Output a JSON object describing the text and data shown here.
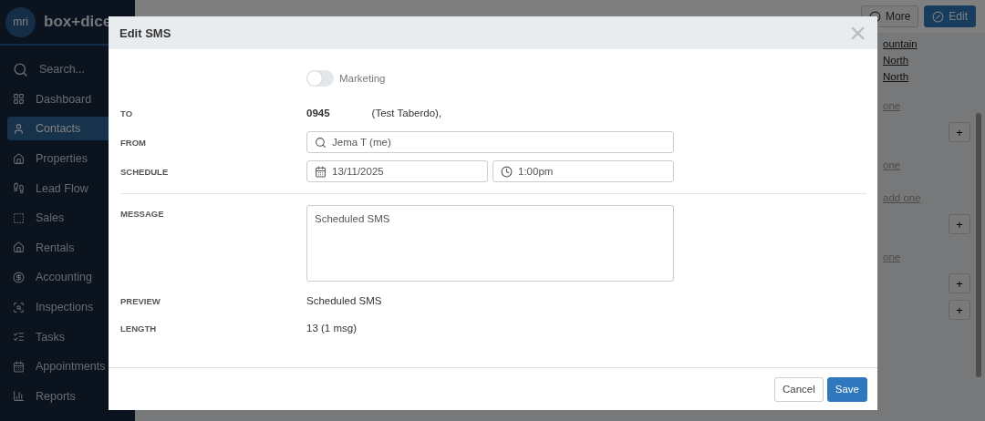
{
  "sidebar": {
    "logo_mark": "mri",
    "logo_text": "box+dice",
    "items": [
      {
        "label": "Search...",
        "selected": false
      },
      {
        "label": "Dashboard",
        "selected": false
      },
      {
        "label": "Contacts",
        "selected": true
      },
      {
        "label": "Properties",
        "selected": false
      },
      {
        "label": "Lead Flow",
        "selected": false
      },
      {
        "label": "Sales",
        "selected": false
      },
      {
        "label": "Rentals",
        "selected": false
      },
      {
        "label": "Accounting",
        "selected": false
      },
      {
        "label": "Inspections",
        "selected": false
      },
      {
        "label": "Tasks",
        "selected": false
      },
      {
        "label": "Appointments",
        "selected": false
      },
      {
        "label": "Reports",
        "selected": false
      }
    ]
  },
  "page": {
    "actions": [
      {
        "label": "More",
        "primary": false
      },
      {
        "label": "Edit",
        "primary": true
      }
    ],
    "side_items": [
      {
        "kind": "link",
        "text": "ountain"
      },
      {
        "kind": "link",
        "text": "North"
      },
      {
        "kind": "link",
        "text": "North"
      },
      {
        "kind": "add",
        "text": "one"
      },
      {
        "kind": "plus",
        "text": "+"
      },
      {
        "kind": "add",
        "text": "one"
      },
      {
        "kind": "add",
        "text": "add one"
      },
      {
        "kind": "plus",
        "text": "+"
      },
      {
        "kind": "add",
        "text": "one"
      },
      {
        "kind": "plus",
        "text": "+"
      },
      {
        "kind": "plus",
        "text": "+"
      }
    ]
  },
  "modal": {
    "title": "Edit SMS",
    "close": "×",
    "marketing": {
      "label": "Marketing",
      "on": false
    },
    "to": {
      "label": "TO",
      "number": "0945",
      "name": "(Test Taberdo),"
    },
    "from": {
      "label": "FROM",
      "value": "Jema T (me)"
    },
    "schedule": {
      "label": "SCHEDULE",
      "date": "13/11/2025",
      "time": "1:00pm"
    },
    "message": {
      "label": "MESSAGE",
      "value": "Scheduled SMS"
    },
    "preview": {
      "label": "PREVIEW",
      "value": "Scheduled SMS"
    },
    "length": {
      "label": "LENGTH",
      "value": "13 (1 msg)"
    },
    "buttons": [
      {
        "label": "Cancel",
        "primary": false
      },
      {
        "label": "Save",
        "primary": true
      }
    ]
  }
}
